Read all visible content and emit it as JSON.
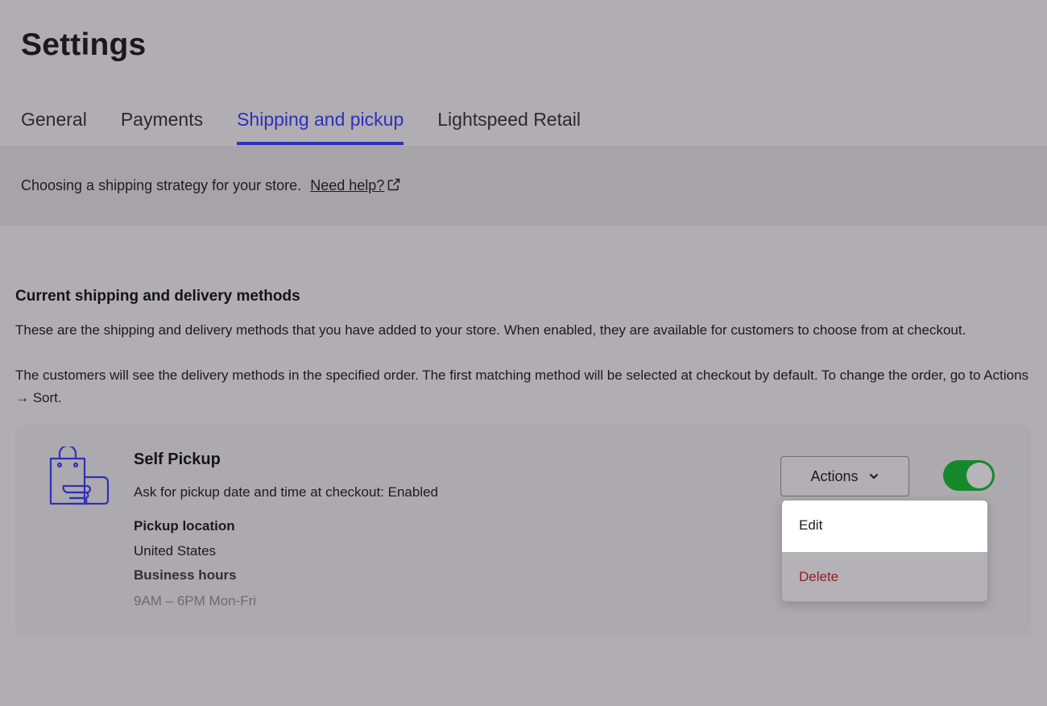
{
  "page": {
    "title": "Settings"
  },
  "tabs": [
    {
      "label": "General"
    },
    {
      "label": "Payments"
    },
    {
      "label": "Shipping and pickup",
      "active": true
    },
    {
      "label": "Lightspeed Retail"
    }
  ],
  "info": {
    "text": "Choosing a shipping strategy for your store.",
    "link": "Need help?",
    "link_icon": "external-link-icon"
  },
  "section": {
    "title": "Current shipping and delivery methods",
    "para1": "These are the shipping and delivery methods that you have added to your store. When enabled, they are available for customers to choose from at checkout.",
    "para2": "The customers will see the delivery methods in the specified order. The first matching method will be selected at checkout by default. To change the order, go to Actions → Sort."
  },
  "method": {
    "icon": "shopping-bag-hand-icon",
    "name": "Self Pickup",
    "ask": "Ask for pickup date and time at checkout: Enabled",
    "pickup_label": "Pickup location",
    "pickup_value": "United States",
    "hours_label": "Business hours",
    "hours_value": "9AM – 6PM Mon-Fri",
    "actions_label": "Actions",
    "enabled": true
  },
  "dropdown": {
    "items": [
      {
        "label": "Edit"
      },
      {
        "label": "Delete"
      }
    ]
  },
  "colors": {
    "accent": "#2f30b8",
    "toggle_on": "#15882c",
    "danger": "#8f2024"
  }
}
